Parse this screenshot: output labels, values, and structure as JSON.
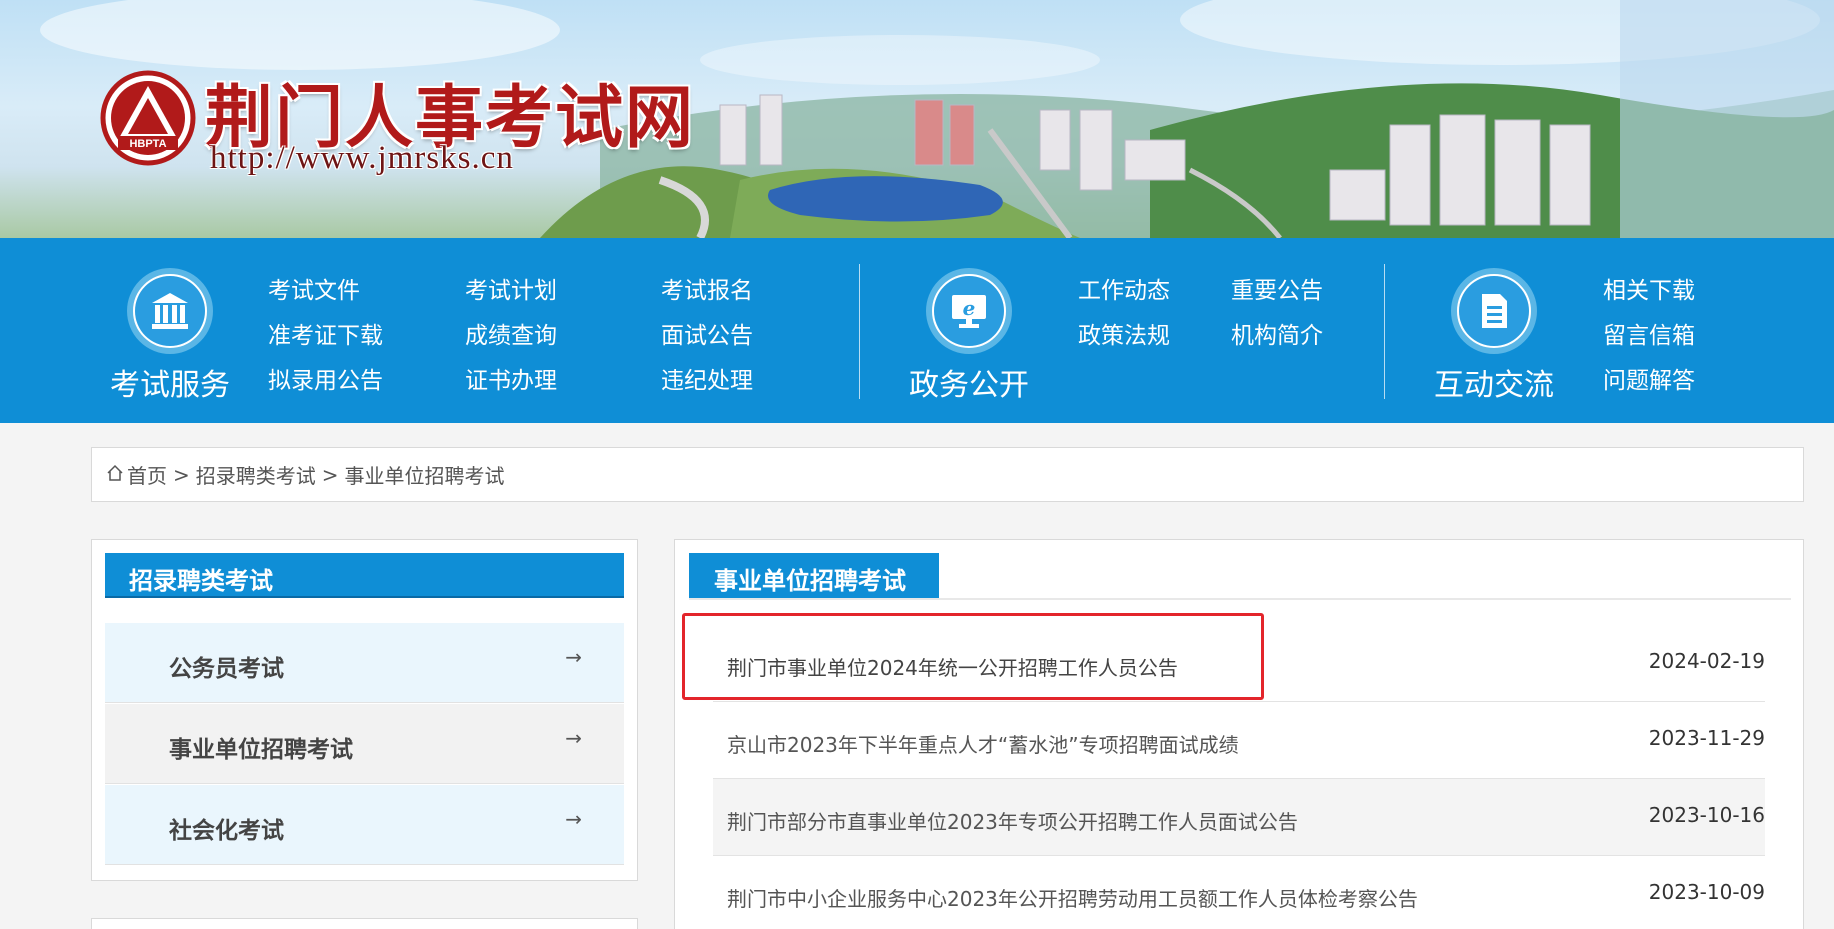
{
  "banner": {
    "title": "荆门人事考试网",
    "url": "http://www.jmrsks.cn",
    "seal_text": "HBPTA"
  },
  "nav": {
    "groups": [
      {
        "title": "考试服务",
        "icon": "building-icon",
        "links": [
          "考试文件",
          "考试计划",
          "考试报名",
          "准考证下载",
          "成绩查询",
          "面试公告",
          "拟录用公告",
          "证书办理",
          "违纪处理"
        ]
      },
      {
        "title": "政务公开",
        "icon": "computer-ie-icon",
        "links": [
          "工作动态",
          "重要公告",
          "政策法规",
          "机构简介"
        ]
      },
      {
        "title": "互动交流",
        "icon": "document-icon",
        "links": [
          "相关下载",
          "留言信箱",
          "问题解答"
        ]
      }
    ]
  },
  "breadcrumb": {
    "home": "首页",
    "sep": ">",
    "level1": "招录聘类考试",
    "level2": "事业单位招聘考试"
  },
  "sidebar": {
    "title": "招录聘类考试",
    "items": [
      {
        "label": "公务员考试",
        "arrow": "→"
      },
      {
        "label": "事业单位招聘考试",
        "arrow": "→"
      },
      {
        "label": "社会化考试",
        "arrow": "→"
      }
    ]
  },
  "main": {
    "title": "事业单位招聘考试",
    "news": [
      {
        "title": "荆门市事业单位2024年统一公开招聘工作人员公告",
        "date": "2024-02-19"
      },
      {
        "title": "京山市2023年下半年重点人才“蓄水池”专项招聘面试成绩",
        "date": "2023-11-29"
      },
      {
        "title": "荆门市部分市直事业单位2023年专项公开招聘工作人员面试公告",
        "date": "2023-10-16"
      },
      {
        "title": "荆门市中小企业服务中心2023年公开招聘劳动用工员额工作人员体检考察公告",
        "date": "2023-10-09"
      }
    ]
  },
  "colors": {
    "nav_blue": "#0f8ed6",
    "title_red": "#b11a1a",
    "highlight_red": "#e3252b"
  }
}
